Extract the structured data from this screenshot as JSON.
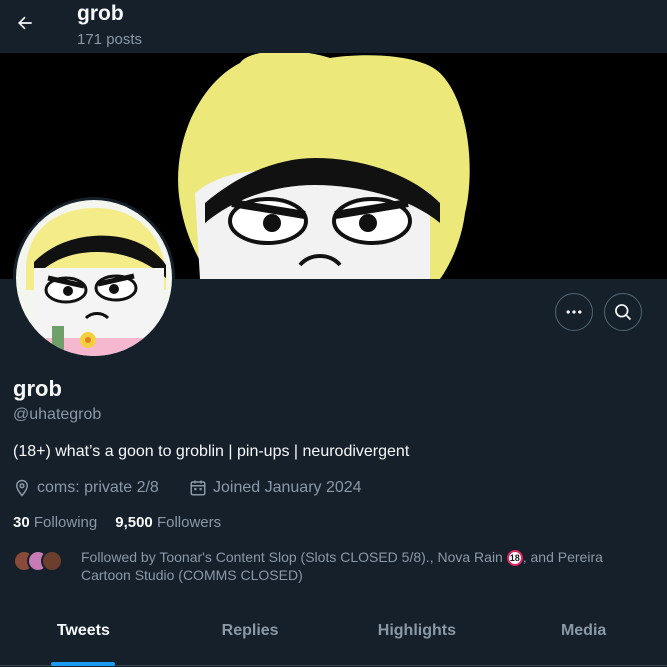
{
  "header": {
    "name": "grob",
    "posts": "171 posts"
  },
  "profile": {
    "display_name": "grob",
    "handle": "@uhategrob",
    "bio": "(18+) what’s a goon to groblin | pin-ups | neurodivergent",
    "location": "coms: private 2/8",
    "joined": "Joined January 2024",
    "following_count": "30",
    "following_label": "Following",
    "followers_count": "9,500",
    "followers_label": "Followers"
  },
  "followed_by": {
    "prefix": "Followed by Toonar's Content Slop (Slots CLOSED 5/8)., Nova Rain",
    "badge": "18",
    "suffix": ", and Pereira Cartoon Studio (COMMS CLOSED)"
  },
  "tabs": [
    {
      "label": "Tweets",
      "active": true
    },
    {
      "label": "Replies",
      "active": false
    },
    {
      "label": "Highlights",
      "active": false
    },
    {
      "label": "Media",
      "active": false
    }
  ],
  "icons": {
    "back": "arrow-left-icon",
    "more": "more-dots-icon",
    "search": "search-icon",
    "location": "location-pin-icon",
    "calendar": "calendar-icon"
  },
  "colors": {
    "background": "#15202b",
    "text_primary": "#f7f9f9",
    "text_secondary": "#8b98a5",
    "accent": "#1d9bf0",
    "border": "#536471"
  }
}
